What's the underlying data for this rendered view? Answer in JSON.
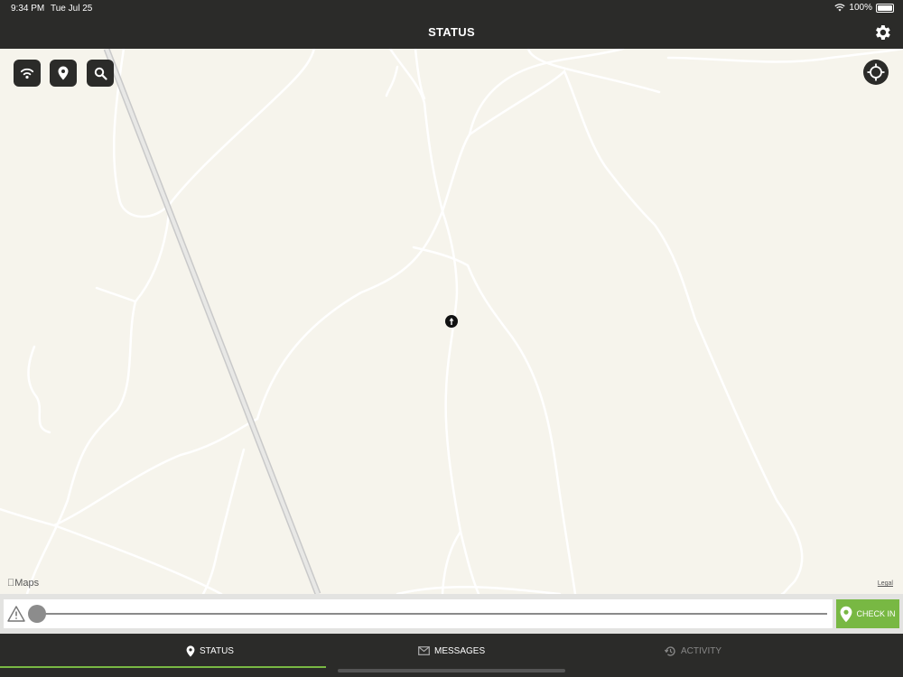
{
  "status_bar": {
    "time": "9:34 PM",
    "date": "Tue Jul 25",
    "battery": "100%"
  },
  "header": {
    "title": "STATUS",
    "settings_icon": "gear-icon"
  },
  "map": {
    "controls": [
      "wifi-icon",
      "map-pin-icon",
      "search-icon"
    ],
    "locate_icon": "crosshair-icon",
    "attribution": "Maps",
    "legal": "Legal",
    "background_color": "#f6f4ec"
  },
  "control_bar": {
    "warning_icon": "warning-triangle-icon",
    "slider_value": 0,
    "check_in_label": "CHECK IN",
    "accent_color": "#78b843"
  },
  "tabs": [
    {
      "label": "STATUS",
      "icon": "map-pin-icon",
      "active": true
    },
    {
      "label": "MESSAGES",
      "icon": "envelope-icon",
      "active": false
    },
    {
      "label": "ACTIVITY",
      "icon": "history-icon",
      "active": false
    }
  ]
}
